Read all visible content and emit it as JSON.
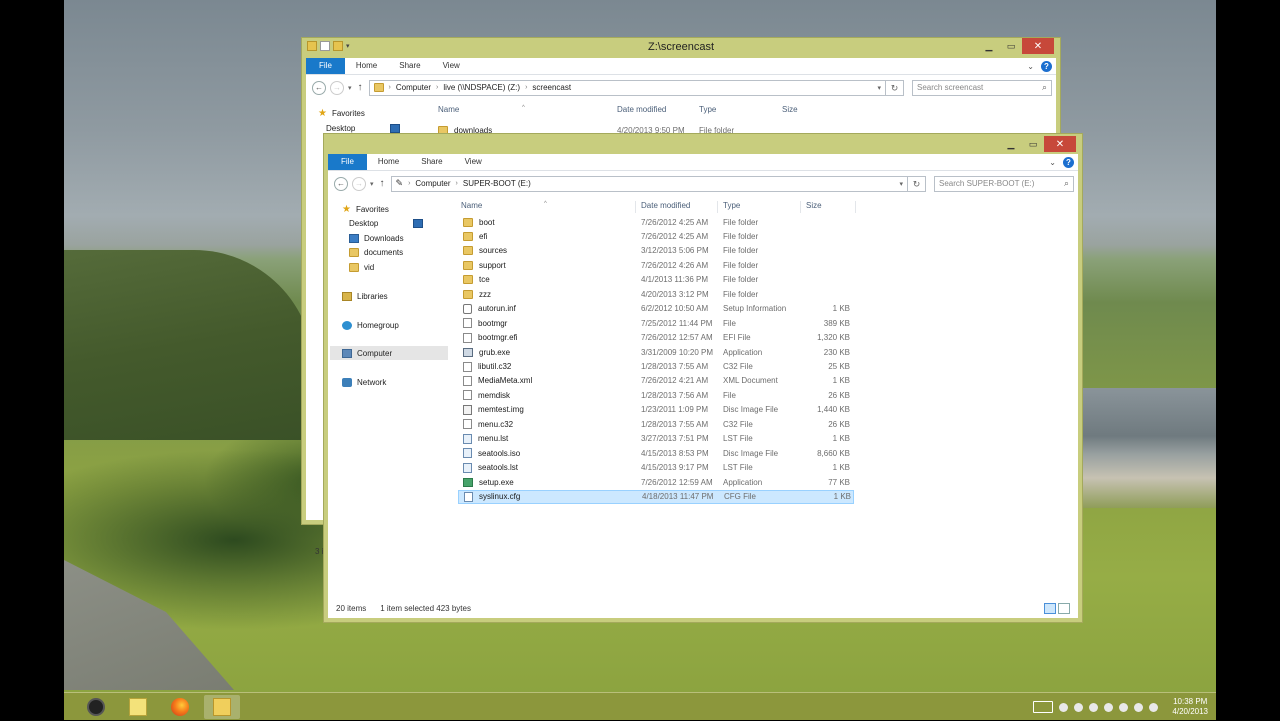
{
  "back_window": {
    "title": "Z:\\screencast",
    "tabs": [
      "File",
      "Home",
      "Share",
      "View"
    ],
    "address": [
      "Computer",
      "live (\\\\NDSPACE) (Z:)",
      "screencast"
    ],
    "search_placeholder": "Search screencast",
    "columns": [
      "Name",
      "Date modified",
      "Type",
      "Size"
    ],
    "nav": [
      "Favorites",
      "Desktop"
    ],
    "rows": [
      {
        "name": "downloads",
        "date": "4/20/2013 9:50 PM",
        "type": "File folder",
        "size": ""
      }
    ],
    "status_partial": "3 i"
  },
  "front_window": {
    "title": "",
    "tabs": [
      "File",
      "Home",
      "Share",
      "View"
    ],
    "address": [
      "Computer",
      "SUPER-BOOT (E:)"
    ],
    "search_placeholder": "Search SUPER-BOOT (E:)",
    "columns": [
      "Name",
      "Date modified",
      "Type",
      "Size"
    ],
    "nav": {
      "favorites": "Favorites",
      "desktop": "Desktop",
      "downloads": "Downloads",
      "documents": "documents",
      "vid": "vid",
      "libraries": "Libraries",
      "homegroup": "Homegroup",
      "computer": "Computer",
      "network": "Network"
    },
    "rows": [
      {
        "name": "boot",
        "date": "7/26/2012 4:25 AM",
        "type": "File folder",
        "size": "",
        "icon": "folder"
      },
      {
        "name": "efi",
        "date": "7/26/2012 4:25 AM",
        "type": "File folder",
        "size": "",
        "icon": "folder"
      },
      {
        "name": "sources",
        "date": "3/12/2013 5:06 PM",
        "type": "File folder",
        "size": "",
        "icon": "folder"
      },
      {
        "name": "support",
        "date": "7/26/2012 4:26 AM",
        "type": "File folder",
        "size": "",
        "icon": "folder"
      },
      {
        "name": "tce",
        "date": "4/1/2013 11:36 PM",
        "type": "File folder",
        "size": "",
        "icon": "folder"
      },
      {
        "name": "zzz",
        "date": "4/20/2013 3:12 PM",
        "type": "File folder",
        "size": "",
        "icon": "folder"
      },
      {
        "name": "autorun.inf",
        "date": "6/2/2012 10:50 AM",
        "type": "Setup Information",
        "size": "1 KB",
        "icon": "gear"
      },
      {
        "name": "bootmgr",
        "date": "7/25/2012 11:44 PM",
        "type": "File",
        "size": "389 KB",
        "icon": "file"
      },
      {
        "name": "bootmgr.efi",
        "date": "7/26/2012 12:57 AM",
        "type": "EFI File",
        "size": "1,320 KB",
        "icon": "file"
      },
      {
        "name": "grub.exe",
        "date": "3/31/2009 10:20 PM",
        "type": "Application",
        "size": "230 KB",
        "icon": "app"
      },
      {
        "name": "libutil.c32",
        "date": "1/28/2013 7:55 AM",
        "type": "C32 File",
        "size": "25 KB",
        "icon": "file"
      },
      {
        "name": "MediaMeta.xml",
        "date": "7/26/2012 4:21 AM",
        "type": "XML Document",
        "size": "1 KB",
        "icon": "file"
      },
      {
        "name": "memdisk",
        "date": "1/28/2013 7:56 AM",
        "type": "File",
        "size": "26 KB",
        "icon": "file"
      },
      {
        "name": "memtest.img",
        "date": "1/23/2011 1:09 PM",
        "type": "Disc Image File",
        "size": "1,440 KB",
        "icon": "disc"
      },
      {
        "name": "menu.c32",
        "date": "1/28/2013 7:55 AM",
        "type": "C32 File",
        "size": "26 KB",
        "icon": "file"
      },
      {
        "name": "menu.lst",
        "date": "3/27/2013 7:51 PM",
        "type": "LST File",
        "size": "1 KB",
        "icon": "lst"
      },
      {
        "name": "seatools.iso",
        "date": "4/15/2013 8:53 PM",
        "type": "Disc Image File",
        "size": "8,660 KB",
        "icon": "lst"
      },
      {
        "name": "seatools.lst",
        "date": "4/15/2013 9:17 PM",
        "type": "LST File",
        "size": "1 KB",
        "icon": "lst"
      },
      {
        "name": "setup.exe",
        "date": "7/26/2012 12:59 AM",
        "type": "Application",
        "size": "77 KB",
        "icon": "setup"
      },
      {
        "name": "syslinux.cfg",
        "date": "4/18/2013 11:47 PM",
        "type": "CFG File",
        "size": "1 KB",
        "icon": "cfg",
        "selected": true
      }
    ],
    "status": {
      "items": "20 items",
      "selected": "1 item selected  423 bytes"
    }
  },
  "taskbar": {
    "apps": [
      "obs-icon",
      "sticky-notes-icon",
      "firefox-icon",
      "file-explorer-icon"
    ],
    "time": "10:38 PM",
    "date": "4/20/2013"
  },
  "colors": {
    "window_frame": "#c8cd7e",
    "file_tab": "#1979ca",
    "close_button": "#c7483a",
    "selection": "#cce8ff"
  }
}
